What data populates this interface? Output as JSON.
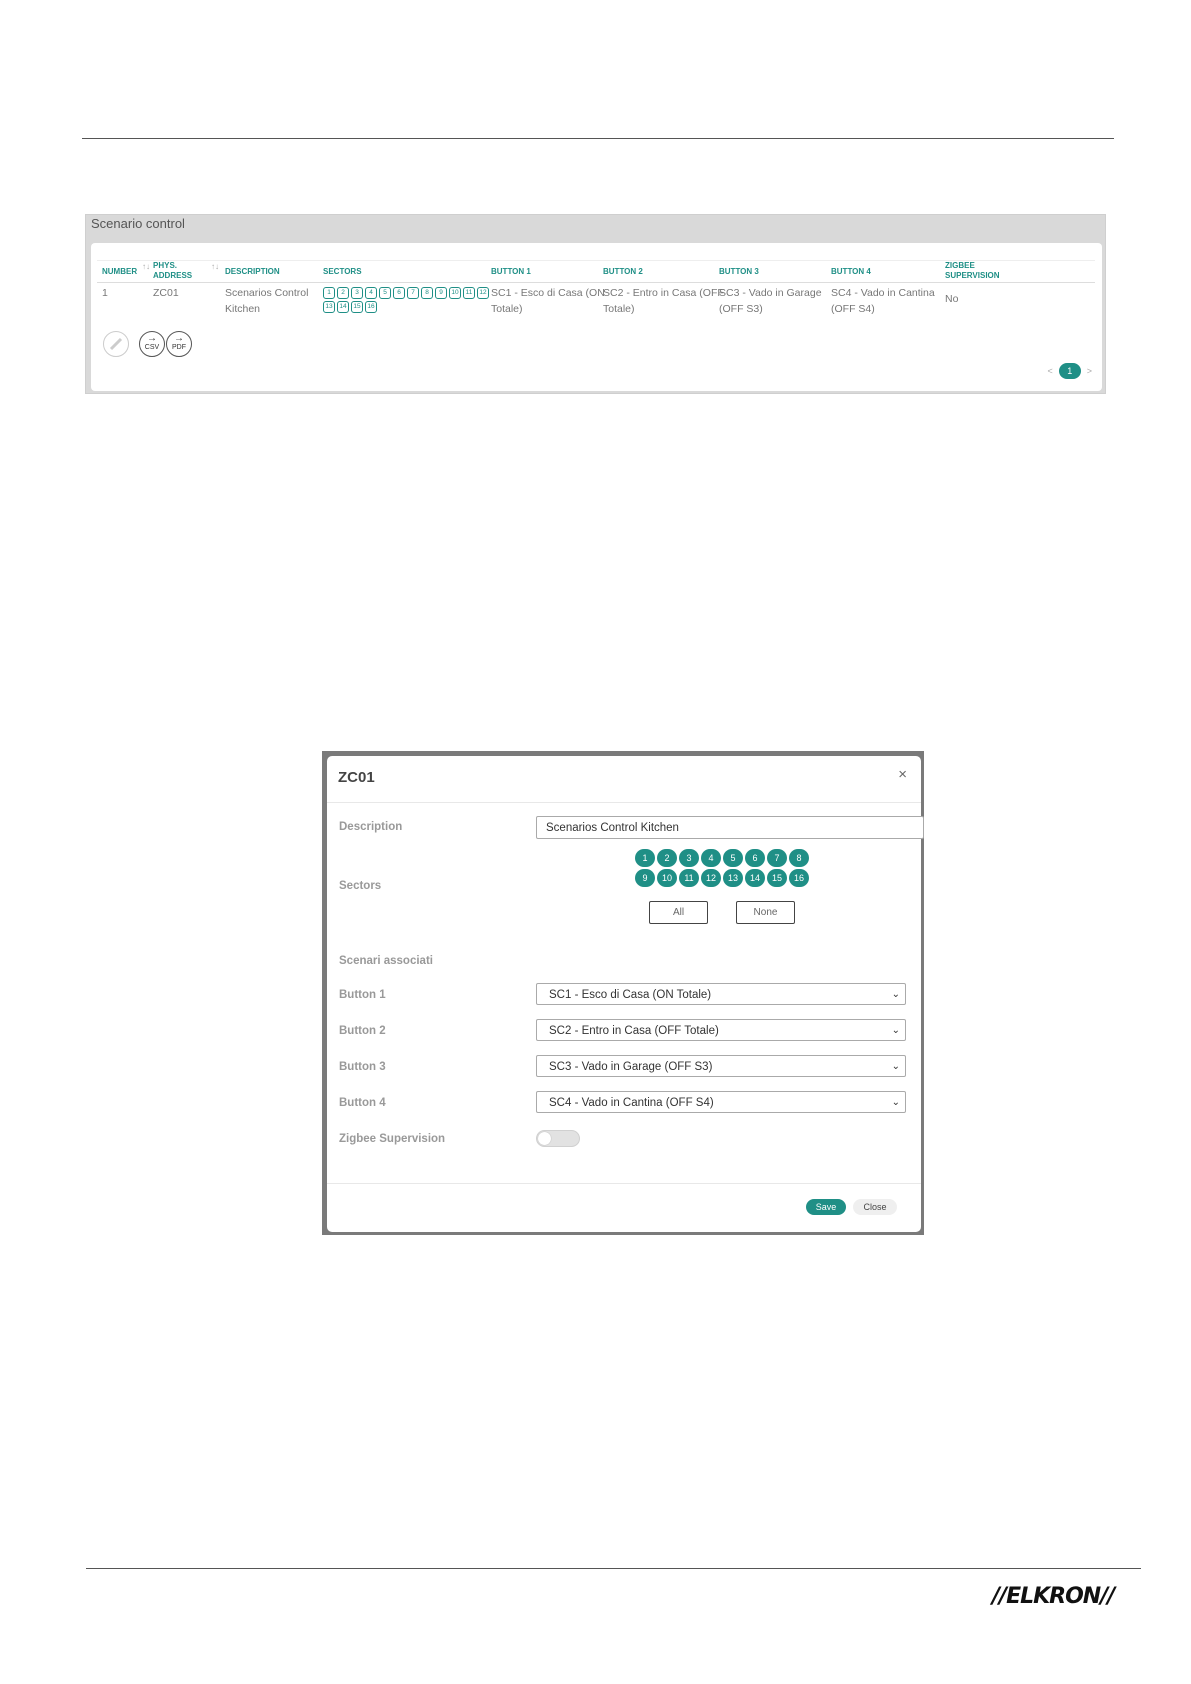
{
  "panel": {
    "title": "Scenario control",
    "headers": {
      "number": "NUMBER",
      "phys_address_1": "PHYS.",
      "phys_address_2": "ADDRESS",
      "description": "DESCRIPTION",
      "sectors": "SECTORS",
      "button1": "BUTTON 1",
      "button2": "BUTTON 2",
      "button3": "BUTTON 3",
      "button4": "BUTTON 4",
      "zigbee_1": "ZIGBEE",
      "zigbee_2": "SUPERVISION"
    },
    "row": {
      "number": "1",
      "phys_address": "ZC01",
      "description_1": "Scenarios Control",
      "description_2": "Kitchen",
      "sectors": [
        "1",
        "2",
        "3",
        "4",
        "5",
        "6",
        "7",
        "8",
        "9",
        "10",
        "11",
        "12",
        "13",
        "14",
        "15",
        "16"
      ],
      "button1_1": "SC1 - Esco di Casa (ON",
      "button1_2": "Totale)",
      "button2_1": "SC2 - Entro in Casa (OFF",
      "button2_2": "Totale)",
      "button3_1": "SC3 - Vado in Garage",
      "button3_2": "(OFF S3)",
      "button4_1": "SC4 - Vado in Cantina",
      "button4_2": "(OFF S4)",
      "zigbee": "No"
    },
    "export": {
      "csv": "CSV",
      "pdf": "PDF"
    },
    "pager": {
      "prev": "<",
      "page": "1",
      "next": ">"
    }
  },
  "modal": {
    "title": "ZC01",
    "close_glyph": "×",
    "description_label": "Description",
    "description_value": "Scenarios Control Kitchen",
    "sectors_label": "Sectors",
    "sectors": [
      "1",
      "2",
      "3",
      "4",
      "5",
      "6",
      "7",
      "8",
      "9",
      "10",
      "11",
      "12",
      "13",
      "14",
      "15",
      "16"
    ],
    "all_label": "All",
    "none_label": "None",
    "scenari_label": "Scenari associati",
    "button1_label": "Button 1",
    "button1_value": "SC1 - Esco di Casa (ON Totale)",
    "button2_label": "Button 2",
    "button2_value": "SC2 - Entro in Casa (OFF Totale)",
    "button3_label": "Button 3",
    "button3_value": "SC3 - Vado in Garage (OFF S3)",
    "button4_label": "Button 4",
    "button4_value": "SC4 - Vado in Cantina (OFF S4)",
    "zigbee_label": "Zigbee Supervision",
    "zigbee_on": false,
    "save_label": "Save",
    "close_label": "Close"
  },
  "colors": {
    "accent": "#1f8f86"
  },
  "footer": {
    "logo": "//ELKRON//"
  }
}
